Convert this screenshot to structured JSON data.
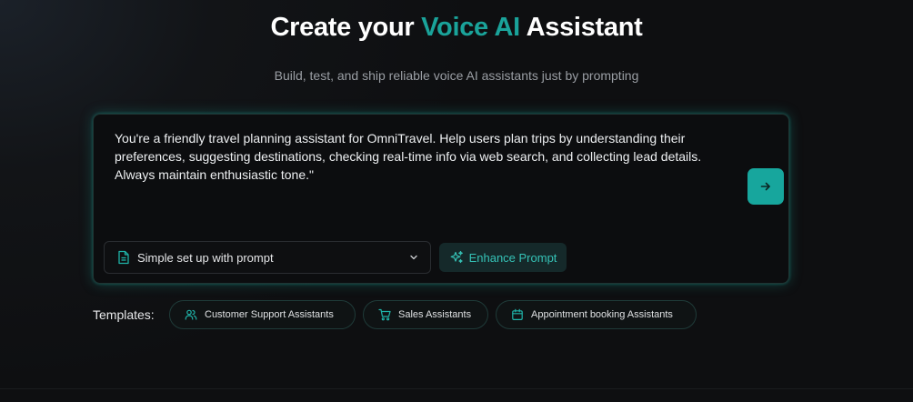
{
  "hero": {
    "title_prefix": "Create your ",
    "title_accent": "Voice AI",
    "title_suffix": " Assistant",
    "subtitle": "Build, test, and ship reliable voice AI assistants just by prompting"
  },
  "prompt": {
    "text": "You're a friendly travel planning assistant for OmniTravel. Help users plan trips by understanding their preferences, suggesting destinations, checking real-time info via web search, and collecting lead details. Always maintain enthusiastic tone.\"",
    "send_icon": "arrow-right-icon"
  },
  "setup": {
    "icon": "document-icon",
    "selected": "Simple set up with prompt",
    "chevron_icon": "chevron-down-icon"
  },
  "enhance": {
    "icon": "sparkles-icon",
    "label": "Enhance Prompt"
  },
  "templates": {
    "label": "Templates:",
    "items": [
      {
        "label": "Customer Support Assistants",
        "icon": "users-icon"
      },
      {
        "label": "Sales Assistants",
        "icon": "cart-icon"
      },
      {
        "label": "Appointment booking Assistants",
        "icon": "calendar-icon"
      }
    ]
  },
  "colors": {
    "accent": "#1aa39a",
    "background": "#0f1012",
    "card_glow": "#1ca096"
  }
}
